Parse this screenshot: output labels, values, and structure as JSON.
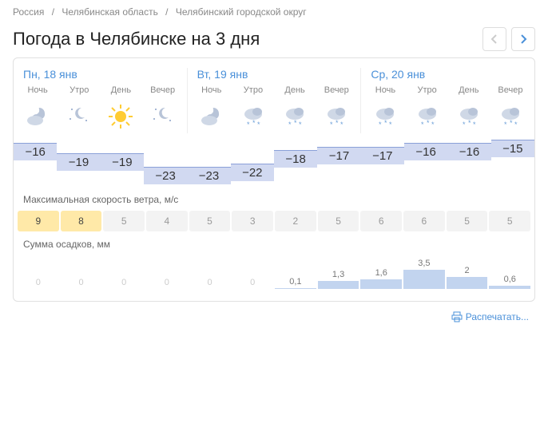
{
  "breadcrumb": {
    "items": [
      "Россия",
      "Челябинская область",
      "Челябинский городской округ"
    ]
  },
  "title": "Погода в Челябинске на 3 дня",
  "part_labels": [
    "Ночь",
    "Утро",
    "День",
    "Вечер"
  ],
  "days": [
    {
      "label": "Пн, 18 янв",
      "parts": [
        {
          "icon": "moon-cloud",
          "temp": -16,
          "wind": 9,
          "wind_hi": true,
          "precip": 0
        },
        {
          "icon": "moon-stars",
          "temp": -19,
          "wind": 8,
          "wind_hi": true,
          "precip": 0
        },
        {
          "icon": "sun",
          "temp": -19,
          "wind": 5,
          "wind_hi": false,
          "precip": 0
        },
        {
          "icon": "moon-stars",
          "temp": -23,
          "wind": 4,
          "wind_hi": false,
          "precip": 0
        }
      ]
    },
    {
      "label": "Вт, 19 янв",
      "parts": [
        {
          "icon": "moon-cloud",
          "temp": -23,
          "wind": 5,
          "wind_hi": false,
          "precip": 0
        },
        {
          "icon": "cloud-snow",
          "temp": -22,
          "wind": 3,
          "wind_hi": false,
          "precip": 0
        },
        {
          "icon": "cloud-snow",
          "temp": -18,
          "wind": 2,
          "wind_hi": false,
          "precip": 0.1
        },
        {
          "icon": "cloud-snow",
          "temp": -17,
          "wind": 5,
          "wind_hi": false,
          "precip": 1.3
        }
      ]
    },
    {
      "label": "Ср, 20 янв",
      "parts": [
        {
          "icon": "cloud-snow",
          "temp": -17,
          "wind": 6,
          "wind_hi": false,
          "precip": 1.6
        },
        {
          "icon": "cloud-snow",
          "temp": -16,
          "wind": 6,
          "wind_hi": false,
          "precip": 3.5
        },
        {
          "icon": "cloud-snow",
          "temp": -16,
          "wind": 5,
          "wind_hi": false,
          "precip": 2
        },
        {
          "icon": "cloud-snow",
          "temp": -15,
          "wind": 5,
          "wind_hi": false,
          "precip": 0.6
        }
      ]
    }
  ],
  "labels": {
    "wind": "Максимальная скорость ветра, м/с",
    "precip": "Сумма осадков, мм",
    "print": "Распечатать..."
  },
  "chart_data": {
    "type": "bar",
    "categories": [
      "Пн ночь",
      "Пн утро",
      "Пн день",
      "Пн вечер",
      "Вт ночь",
      "Вт утро",
      "Вт день",
      "Вт вечер",
      "Ср ночь",
      "Ср утро",
      "Ср день",
      "Ср вечер"
    ],
    "series": [
      {
        "name": "temp_c",
        "values": [
          -16,
          -19,
          -19,
          -23,
          -23,
          -22,
          -18,
          -17,
          -17,
          -16,
          -16,
          -15
        ]
      },
      {
        "name": "wind_ms",
        "values": [
          9,
          8,
          5,
          4,
          5,
          3,
          2,
          5,
          6,
          6,
          5,
          5
        ]
      },
      {
        "name": "precip_mm",
        "values": [
          0,
          0,
          0,
          0,
          0,
          0,
          0.1,
          1.3,
          1.6,
          3.5,
          2,
          0.6
        ]
      }
    ]
  },
  "icons": {
    "moon-cloud": "<path fill='#b8c4d8' d='M22 20a6 6 0 1 1-8-5.7A5 5 0 0 0 19 8a5 5 0 0 0-.4-2A7 7 0 0 1 26 13a6 6 0 0 1-4 7z'/><ellipse fill='#cfd8e6' cx='14' cy='22' rx='10' ry='6'/>",
    "moon-stars": "<path fill='#b8c4d8' d='M20 6a7 7 0 1 0 4 12 6 6 0 0 1-4-12z'/><circle fill='#8aa0c8' cx='8' cy='8' r='1'/><circle fill='#8aa0c8' cx='26' cy='22' r='1'/><circle fill='#8aa0c8' cx='6' cy='20' r='1'/>",
    "sun": "<circle fill='#ffcc33' cx='17' cy='17' r='7'/><g stroke='#ffcc33' stroke-width='2'><line x1='17' y1='2' x2='17' y2='7'/><line x1='17' y1='27' x2='17' y2='32'/><line x1='2' y1='17' x2='7' y2='17'/><line x1='27' y1='17' x2='32' y2='17'/><line x1='6' y1='6' x2='10' y2='10'/><line x1='24' y1='24' x2='28' y2='28'/><line x1='6' y1='28' x2='10' y2='24'/><line x1='24' y1='10' x2='28' y2='6'/></g>",
    "cloud-snow": "<ellipse fill='#cfd8e6' cx='17' cy='14' rx='11' ry='7'/><ellipse fill='#b8c4d8' cx='22' cy='11' rx='6' ry='5'/><g fill='#6a9ed8'><text x='9' y='30' font-size='9'>*</text><text x='16' y='28' font-size='9'>*</text><text x='22' y='30' font-size='9'>*</text></g>"
  }
}
